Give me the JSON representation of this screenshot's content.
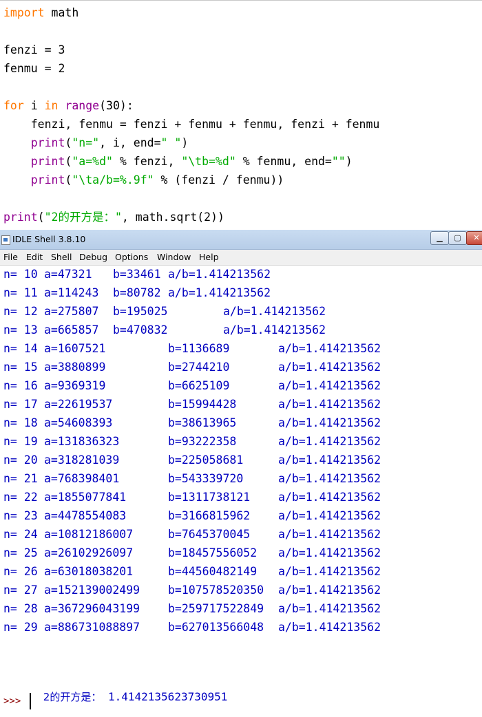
{
  "editor": {
    "lines": [
      {
        "seg": [
          {
            "c": "kw",
            "t": "import"
          },
          {
            "c": "",
            "t": " math"
          }
        ]
      },
      {
        "seg": []
      },
      {
        "seg": [
          {
            "c": "",
            "t": "fenzi = 3"
          }
        ]
      },
      {
        "seg": [
          {
            "c": "",
            "t": "fenmu = 2"
          }
        ]
      },
      {
        "seg": []
      },
      {
        "seg": [
          {
            "c": "kw",
            "t": "for"
          },
          {
            "c": "",
            "t": " i "
          },
          {
            "c": "kw",
            "t": "in"
          },
          {
            "c": "",
            "t": " "
          },
          {
            "c": "bi",
            "t": "range"
          },
          {
            "c": "",
            "t": "(30):"
          }
        ]
      },
      {
        "seg": [
          {
            "c": "",
            "t": "    fenzi, fenmu = fenzi + fenmu + fenmu, fenzi + fenmu"
          }
        ]
      },
      {
        "seg": [
          {
            "c": "",
            "t": "    "
          },
          {
            "c": "bi",
            "t": "print"
          },
          {
            "c": "",
            "t": "("
          },
          {
            "c": "st",
            "t": "\"n=\""
          },
          {
            "c": "",
            "t": ", i, end="
          },
          {
            "c": "st",
            "t": "\" \""
          },
          {
            "c": "",
            "t": ")"
          }
        ]
      },
      {
        "seg": [
          {
            "c": "",
            "t": "    "
          },
          {
            "c": "bi",
            "t": "print"
          },
          {
            "c": "",
            "t": "("
          },
          {
            "c": "st",
            "t": "\"a=%d\""
          },
          {
            "c": "",
            "t": " % fenzi, "
          },
          {
            "c": "st",
            "t": "\"\\tb=%d\""
          },
          {
            "c": "",
            "t": " % fenmu, end="
          },
          {
            "c": "st",
            "t": "\"\""
          },
          {
            "c": "",
            "t": ")"
          }
        ]
      },
      {
        "seg": [
          {
            "c": "",
            "t": "    "
          },
          {
            "c": "bi",
            "t": "print"
          },
          {
            "c": "",
            "t": "("
          },
          {
            "c": "st",
            "t": "\"\\ta/b=%.9f\""
          },
          {
            "c": "",
            "t": " % (fenzi / fenmu))"
          }
        ]
      },
      {
        "seg": []
      },
      {
        "seg": [
          {
            "c": "bi",
            "t": "print"
          },
          {
            "c": "",
            "t": "("
          },
          {
            "c": "st",
            "t": "\"2的开方是：\""
          },
          {
            "c": "",
            "t": ", math.sqrt(2))"
          }
        ]
      }
    ]
  },
  "shell": {
    "title": "IDLE Shell 3.8.10",
    "window_buttons": {
      "minimize": "▁",
      "maximize": "▢",
      "close": "✕"
    },
    "menu": [
      "File",
      "Edit",
      "Shell",
      "Debug",
      "Options",
      "Window",
      "Help"
    ],
    "rows": [
      {
        "n": "n= 10",
        "a": "a=47321",
        "b": "b=33461",
        "r": "a/b=1.414213562",
        "layout": 1
      },
      {
        "n": "n= 11",
        "a": "a=114243",
        "b": "b=80782",
        "r": "a/b=1.414213562",
        "layout": 1
      },
      {
        "n": "n= 12",
        "a": "a=275807",
        "b": "b=195025",
        "r": "a/b=1.414213562",
        "layout": 2
      },
      {
        "n": "n= 13",
        "a": "a=665857",
        "b": "b=470832",
        "r": "a/b=1.414213562",
        "layout": 2
      },
      {
        "n": "n= 14",
        "a": "a=1607521",
        "b": "b=1136689",
        "r": "a/b=1.414213562",
        "layout": 3
      },
      {
        "n": "n= 15",
        "a": "a=3880899",
        "b": "b=2744210",
        "r": "a/b=1.414213562",
        "layout": 3
      },
      {
        "n": "n= 16",
        "a": "a=9369319",
        "b": "b=6625109",
        "r": "a/b=1.414213562",
        "layout": 3
      },
      {
        "n": "n= 17",
        "a": "a=22619537",
        "b": "b=15994428",
        "r": "a/b=1.414213562",
        "layout": 3
      },
      {
        "n": "n= 18",
        "a": "a=54608393",
        "b": "b=38613965",
        "r": "a/b=1.414213562",
        "layout": 3
      },
      {
        "n": "n= 19",
        "a": "a=131836323",
        "b": "b=93222358",
        "r": "a/b=1.414213562",
        "layout": 3
      },
      {
        "n": "n= 20",
        "a": "a=318281039",
        "b": "b=225058681",
        "r": "a/b=1.414213562",
        "layout": 3
      },
      {
        "n": "n= 21",
        "a": "a=768398401",
        "b": "b=543339720",
        "r": "a/b=1.414213562",
        "layout": 3
      },
      {
        "n": "n= 22",
        "a": "a=1855077841",
        "b": "b=1311738121",
        "r": "a/b=1.414213562",
        "layout": 3
      },
      {
        "n": "n= 23",
        "a": "a=4478554083",
        "b": "b=3166815962",
        "r": "a/b=1.414213562",
        "layout": 3
      },
      {
        "n": "n= 24",
        "a": "a=10812186007",
        "b": "b=7645370045",
        "r": "a/b=1.414213562",
        "layout": 3
      },
      {
        "n": "n= 25",
        "a": "a=26102926097",
        "b": "b=18457556052",
        "r": "a/b=1.414213562",
        "layout": 3
      },
      {
        "n": "n= 26",
        "a": "a=63018038201",
        "b": "b=44560482149",
        "r": "a/b=1.414213562",
        "layout": 3
      },
      {
        "n": "n= 27",
        "a": "a=152139002499",
        "b": "b=107578520350",
        "r": "a/b=1.414213562",
        "layout": 3
      },
      {
        "n": "n= 28",
        "a": "a=367296043199",
        "b": "b=259717522849",
        "r": "a/b=1.414213562",
        "layout": 3
      },
      {
        "n": "n= 29",
        "a": "a=886731088897",
        "b": "b=627013566048",
        "r": "a/b=1.414213562",
        "layout": 3
      }
    ],
    "final_label": "2的开方是：",
    "final_value": "1.4142135623730951",
    "prompt": ">>>"
  },
  "colors": {
    "keyword": "#ff7700",
    "builtin": "#900090",
    "string": "#00aa00",
    "stdout": "#0000c0",
    "prompt": "#8b0000"
  }
}
